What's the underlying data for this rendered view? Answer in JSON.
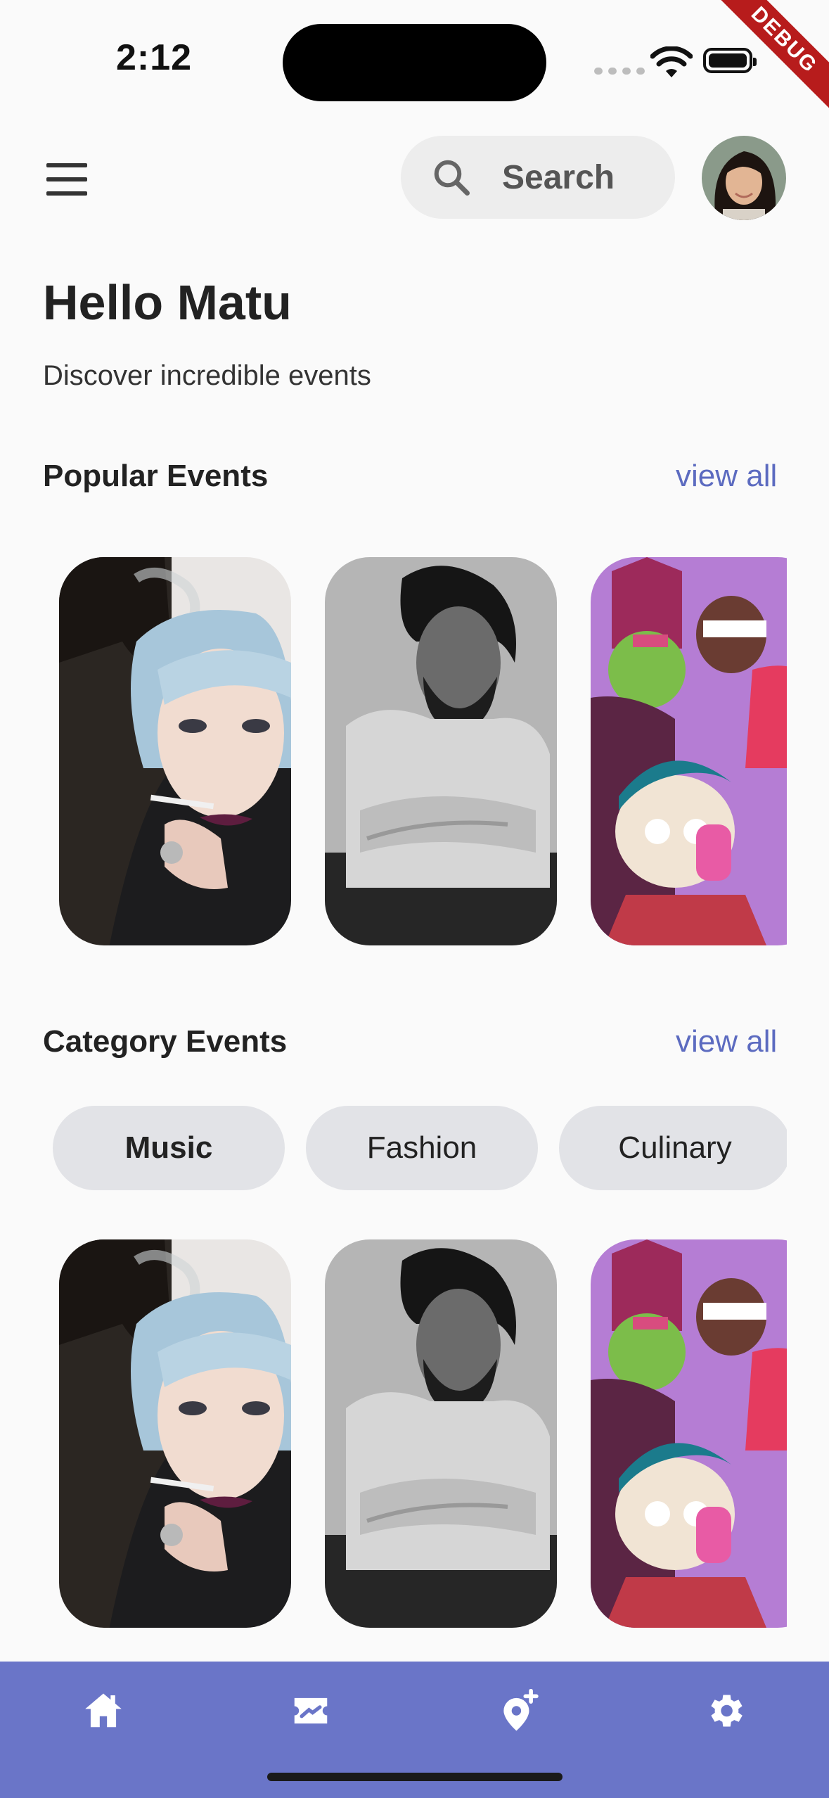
{
  "status_bar": {
    "time": "2:12",
    "debug_label": "DEBUG"
  },
  "header": {
    "search_label": "Search"
  },
  "greeting": {
    "title": "Hello Matu",
    "subtitle": "Discover incredible events"
  },
  "popular": {
    "title": "Popular Events",
    "view_all": "view all"
  },
  "category": {
    "title": "Category Events",
    "view_all": "view all",
    "chips": [
      "Music",
      "Fashion",
      "Culinary"
    ],
    "selected": "Music"
  },
  "colors": {
    "accent": "#5c6bc0",
    "nav_bg": "#6a75c8",
    "chip_bg": "#e2e3e7"
  },
  "nav_icons": [
    "home-icon",
    "ticket-icon",
    "add-location-icon",
    "settings-icon"
  ]
}
